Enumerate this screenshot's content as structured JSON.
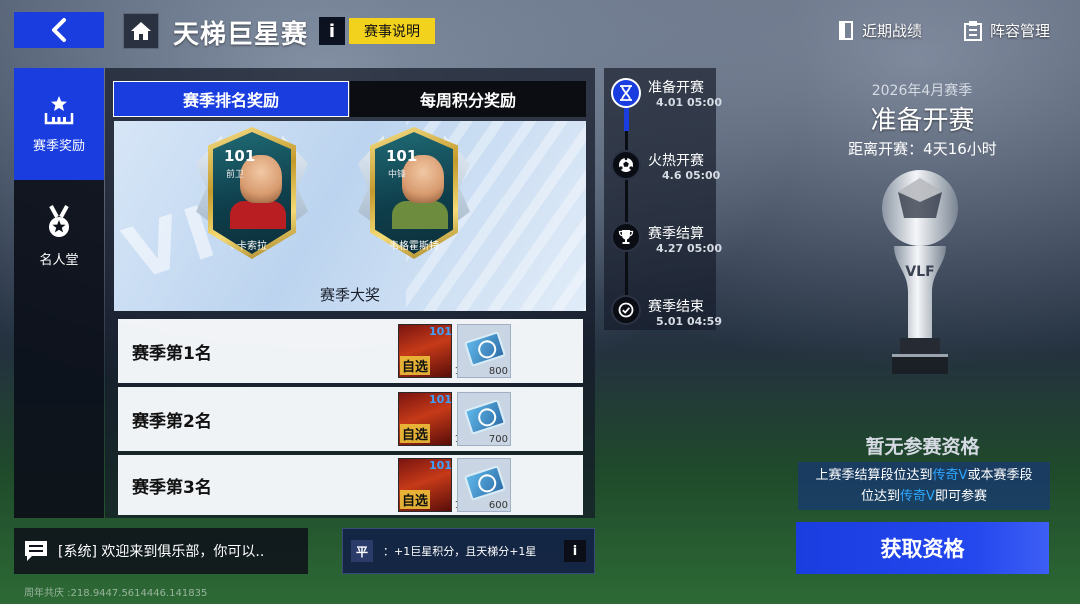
{
  "header": {
    "title": "天梯巨星赛",
    "info_label": "i",
    "rules_label": "赛事说明",
    "recent_record": "近期战绩",
    "lineup_manage": "阵容管理"
  },
  "sidebar": {
    "items": [
      {
        "label": "赛季奖励",
        "icon": "star-podium-icon",
        "active": true
      },
      {
        "label": "名人堂",
        "icon": "medal-icon",
        "active": false
      }
    ]
  },
  "tabs": [
    {
      "label": "赛季排名奖励",
      "active": true
    },
    {
      "label": "每周积分奖励",
      "active": false
    }
  ],
  "grand_prize": {
    "caption": "赛季大奖",
    "cards": [
      {
        "rating": "101",
        "position": "前卫",
        "name": "卡索拉"
      },
      {
        "rating": "101",
        "position": "中锋",
        "name": "韦格霍斯特"
      }
    ]
  },
  "rank_rewards": [
    {
      "label": "赛季第1名",
      "pack_rating": "101",
      "pack_tag": "自选",
      "pack_qty": "1",
      "ticket_amount": "800"
    },
    {
      "label": "赛季第2名",
      "pack_rating": "101",
      "pack_tag": "自选",
      "pack_qty": "1",
      "ticket_amount": "700"
    },
    {
      "label": "赛季第3名",
      "pack_rating": "101",
      "pack_tag": "自选",
      "pack_qty": "1",
      "ticket_amount": "600"
    }
  ],
  "timeline": [
    {
      "label": "准备开赛",
      "time": "4.01 05:00",
      "icon": "hourglass-icon",
      "active": true
    },
    {
      "label": "火热开赛",
      "time": "4.6 05:00",
      "icon": "soccer-ball-icon",
      "active": false
    },
    {
      "label": "赛季结算",
      "time": "4.27 05:00",
      "icon": "trophy-icon",
      "active": false
    },
    {
      "label": "赛季结束",
      "time": "5.01 04:59",
      "icon": "check-circle-icon",
      "active": false
    }
  ],
  "season": {
    "name": "2026年4月赛季",
    "status": "准备开赛",
    "countdown": "距离开赛：4天16小时",
    "trophy_text": "VLF",
    "no_qualification": "暂无参赛资格",
    "qual_line1_pre": "上赛季结算段位达到",
    "qual_hl1": "传奇V",
    "qual_line1_post": "或本赛季段",
    "qual_line2_pre": "位达到",
    "qual_hl2": "传奇V",
    "qual_line2_post": "即可参赛",
    "get_button": "获取资格"
  },
  "chat": {
    "message": "[系统] 欢迎来到俱乐部，你可以.."
  },
  "footer": {
    "coords": "周年共庆 :218.9447.5614446.141835"
  },
  "bonus": {
    "badge": "平",
    "text": "：+1巨星积分，且天梯分+1星",
    "info": "i"
  },
  "colors": {
    "accent_blue": "#1a3de0",
    "rules_yellow": "#f3d21e",
    "highlight_blue": "#2ca8ff"
  }
}
